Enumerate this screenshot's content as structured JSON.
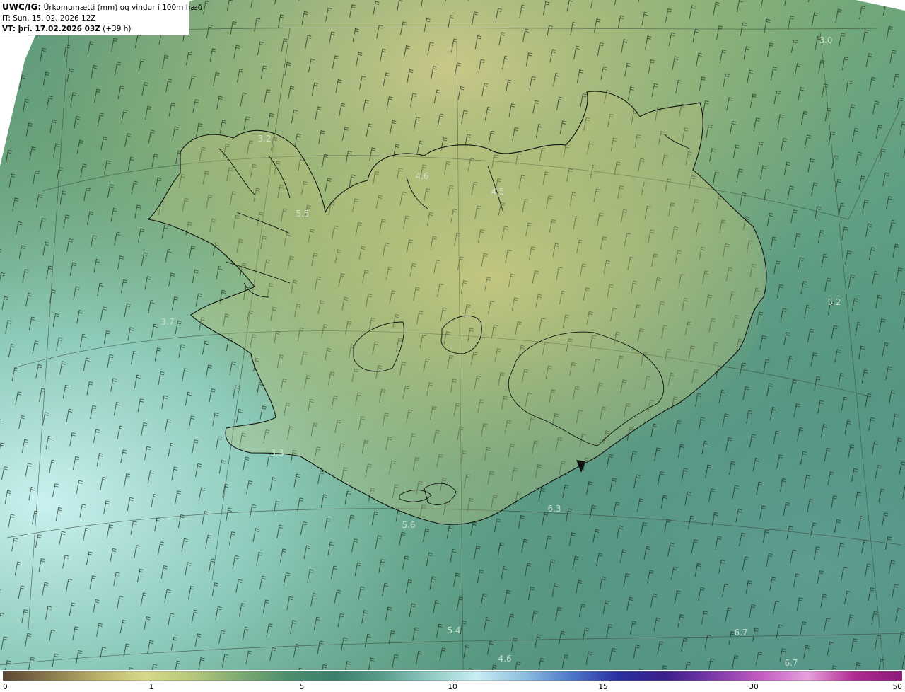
{
  "header": {
    "code": "UWC/IG:",
    "title": " Úrkomumætti (mm) og vindur í 100m hæð",
    "init_time": "IT: Sun. 15. 02. 2026 12Z",
    "valid_label": "VT: þri. 17.02.2026 03Z",
    "valid_lead": " (+39 h)"
  },
  "value_labels": [
    "3.0",
    "3.2",
    "4.6",
    "4.5",
    "5.5",
    "3.7",
    "5.2",
    "3.3",
    "5.6",
    "6.3",
    "5.4",
    "6.7",
    "4.6",
    "6.7"
  ],
  "colorbar": {
    "ticks": [
      "0",
      "1",
      "5",
      "10",
      "15",
      "30",
      "50"
    ],
    "colors": [
      "#5a4632",
      "#8a7a4e",
      "#b9b06a",
      "#d7d98a",
      "#b6c77c",
      "#7eab72",
      "#4e8f6e",
      "#3c7f6c",
      "#5a9c8c",
      "#8fc8c2",
      "#c8eef2",
      "#8fbfe0",
      "#4d78c8",
      "#2a2fa0",
      "#3a1f8a",
      "#7a3aa8",
      "#c25cc0",
      "#e6a0dc",
      "#b02a90",
      "#8a1a78"
    ]
  }
}
